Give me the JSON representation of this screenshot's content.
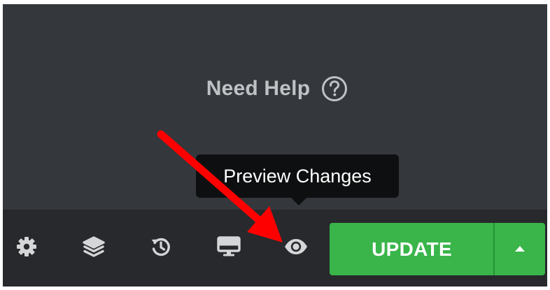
{
  "help": {
    "label": "Need Help",
    "icon": "question-circle-icon"
  },
  "tooltip": {
    "text": "Preview Changes"
  },
  "toolbar": {
    "items": [
      {
        "icon": "gear-icon"
      },
      {
        "icon": "layers-icon"
      },
      {
        "icon": "history-icon"
      },
      {
        "icon": "desktop-icon"
      },
      {
        "icon": "eye-icon"
      }
    ],
    "update_label": "UPDATE",
    "more_icon": "caret-up-icon"
  },
  "colors": {
    "panel_bg": "#34373b",
    "bar_bg": "#27292c",
    "accent_green": "#39b54a",
    "annotation_red": "#ff0000"
  }
}
